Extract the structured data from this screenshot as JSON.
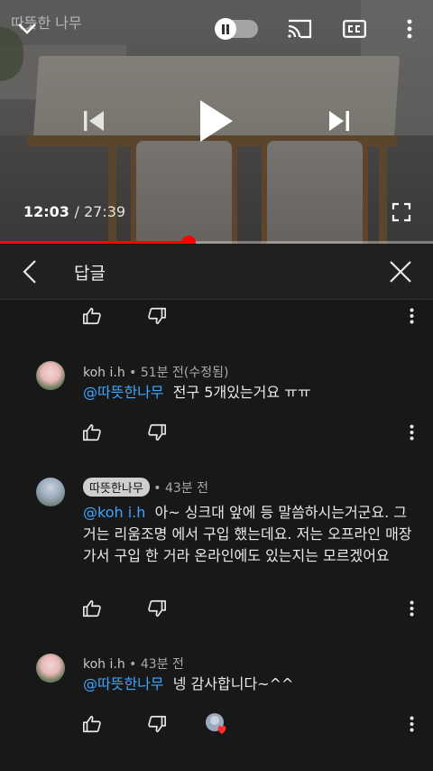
{
  "player": {
    "channel_title": "따뜻한 나무",
    "current_time": "12:03",
    "duration": "/ 27:39",
    "progress": 0.435,
    "accent": "#ff0000"
  },
  "panel": {
    "title": "답글"
  },
  "comments": [
    {
      "author": "koh i.h",
      "meta": "• 51분 전(수정됨)",
      "mention": "@따뜻한나무",
      "text": "전구 5개있는거요 ㅠㅠ"
    },
    {
      "author": "따뜻한나무",
      "meta": "• 43분 전",
      "mention": "@koh i.h",
      "text": "아~  싱크대 앞에 등 말씀하시는거군요. 그거는 리움조명 에서 구입 했는데요. 저는 오프라인 매장 가서 구입 한 거라 온라인에도 있는지는 모르겠어요"
    },
    {
      "author": "koh i.h",
      "meta": "• 43분 전",
      "mention": "@따뜻한나무",
      "text": "넹 감사합니다~^^"
    }
  ],
  "icons": {
    "like": "thumb-up-icon",
    "dislike": "thumb-down-icon",
    "more": "more-vert-icon",
    "hearted": "creator-heart-icon"
  }
}
